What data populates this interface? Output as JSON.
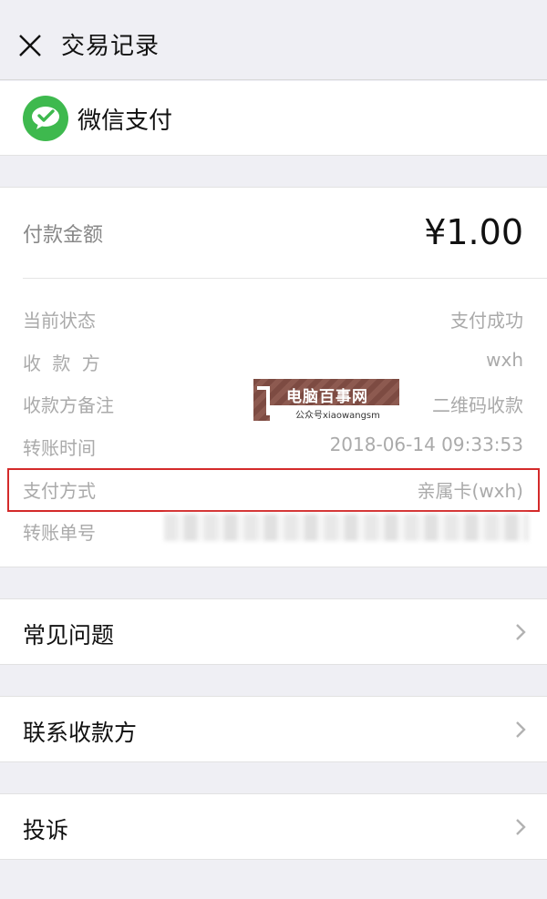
{
  "header": {
    "title": "交易记录",
    "close_icon": "close-icon"
  },
  "brand": {
    "name": "微信支付",
    "icon": "wechat-pay-icon",
    "color": "#3eb94e"
  },
  "payment": {
    "amount_label": "付款金额",
    "amount_value": "¥1.00"
  },
  "details": [
    {
      "label": "当前状态",
      "value": "支付成功"
    },
    {
      "label": "收 款 方",
      "value": "wxh"
    },
    {
      "label": "收款方备注",
      "value": "二维码收款"
    },
    {
      "label": "转账时间",
      "value": "2018-06-14 09:33:53"
    },
    {
      "label": "支付方式",
      "value": "亲属卡(wxh)"
    },
    {
      "label": "转账单号",
      "value": ""
    }
  ],
  "watermark": {
    "title": "电脑百事网",
    "subtitle": "公众号xiaowangsm"
  },
  "menu": [
    {
      "label": "常见问题"
    },
    {
      "label": "联系收款方"
    },
    {
      "label": "投诉"
    }
  ],
  "colors": {
    "background": "#efeff4",
    "highlight": "#d42a2a",
    "muted_text": "#aaaaaa"
  }
}
